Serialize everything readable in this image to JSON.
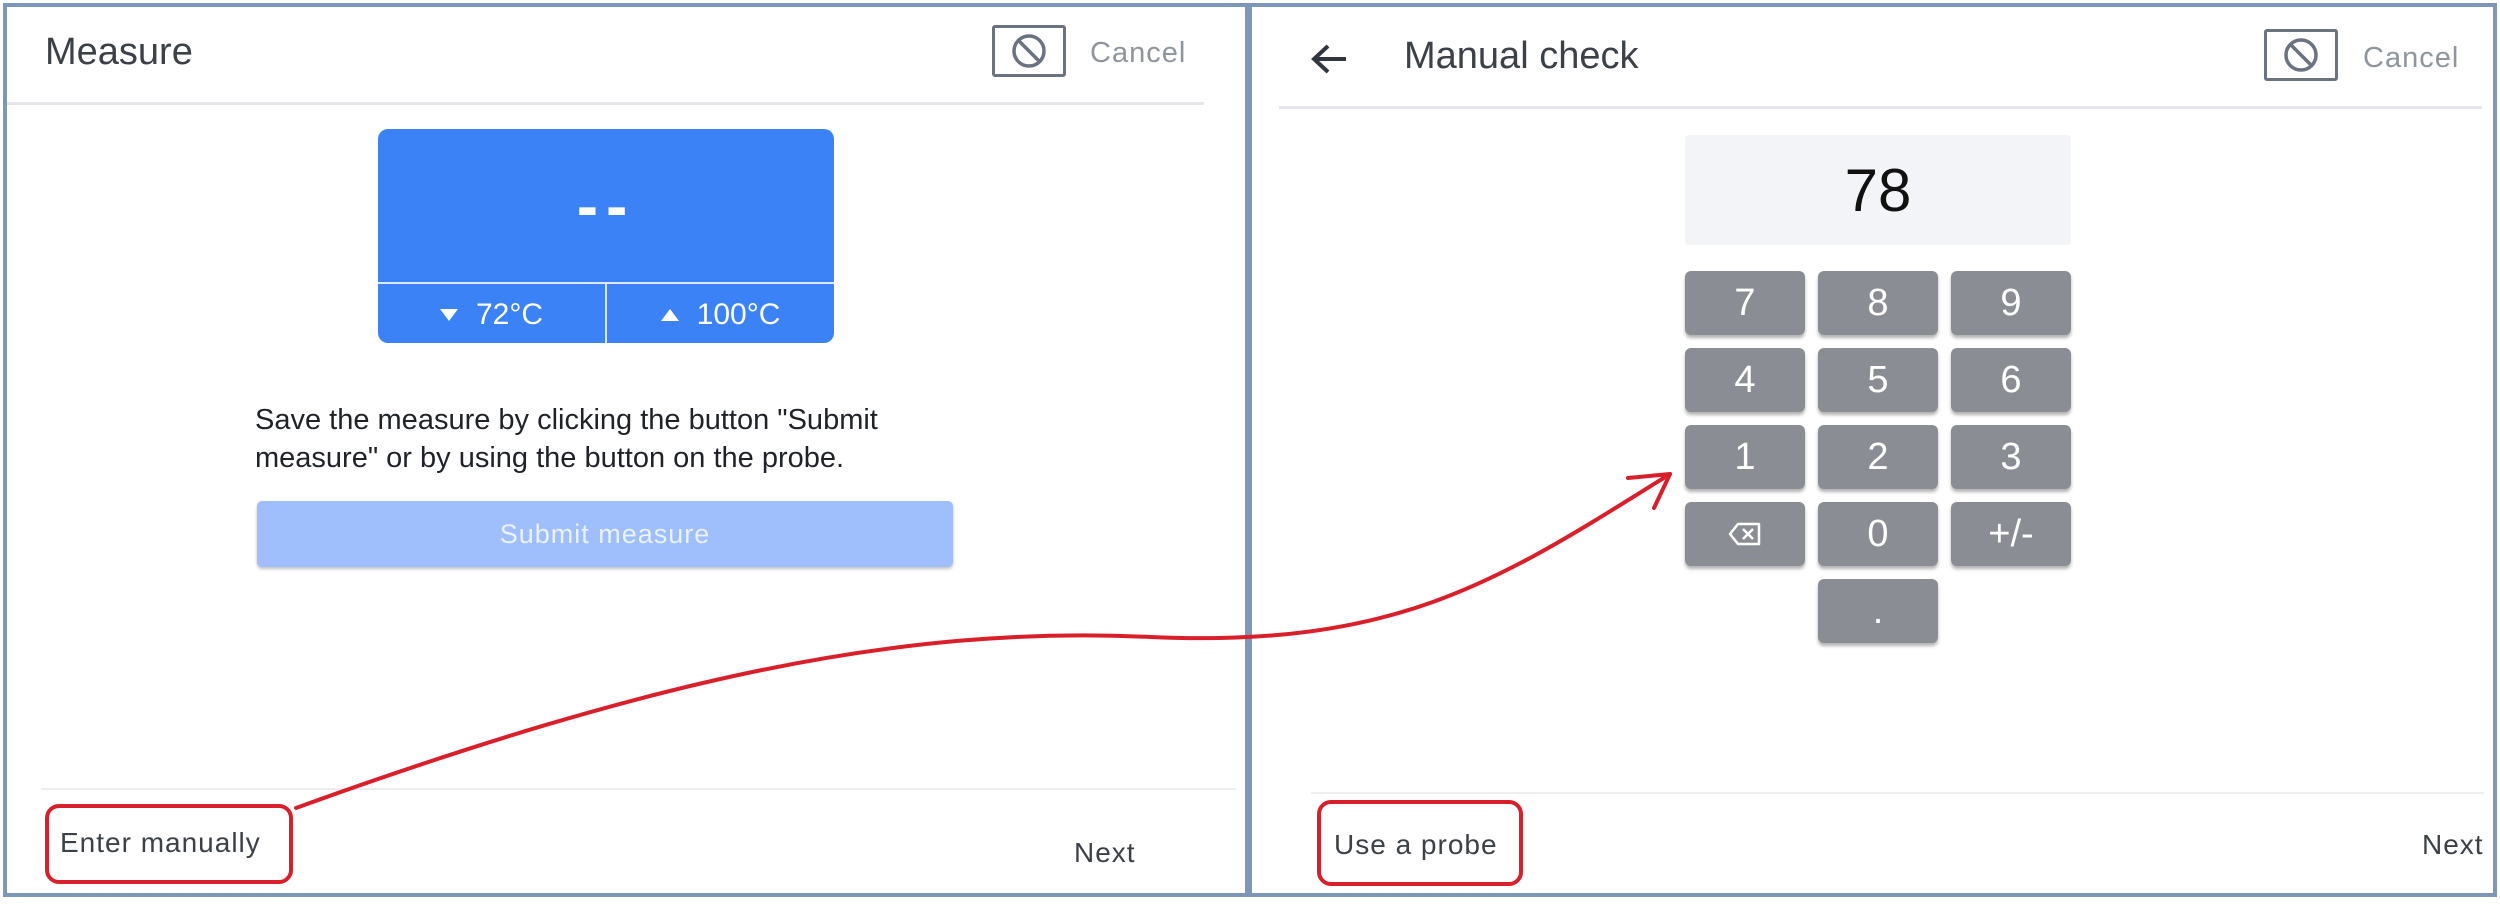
{
  "left_screen": {
    "title": "Measure",
    "cancel_label": "Cancel",
    "measure_value": "--",
    "range_min": "72°C",
    "range_max": "100°C",
    "instructions": "Save the measure by clicking the button \"Submit measure\" or by using the button on the probe.",
    "submit_label": "Submit measure",
    "enter_manually_label": "Enter manually",
    "next_label": "Next"
  },
  "right_screen": {
    "title": "Manual check",
    "cancel_label": "Cancel",
    "entered_value": "78",
    "keys": [
      "7",
      "8",
      "9",
      "4",
      "5",
      "6",
      "1",
      "2",
      "3",
      "⌫",
      "0",
      "+/-",
      "."
    ],
    "use_probe_label": "Use a probe",
    "next_label": "Next"
  },
  "colors": {
    "accent_blue": "#3b82f6",
    "disabled_blue": "#9ebffb",
    "key_gray": "#8a8d93",
    "annotation_red": "#d81f2a",
    "panel_border": "#7d97b8"
  },
  "icons": {
    "cancel": "prohibited-icon",
    "back": "arrow-left-icon",
    "backspace": "backspace-icon",
    "min": "triangle-down-icon",
    "max": "triangle-up-icon"
  }
}
